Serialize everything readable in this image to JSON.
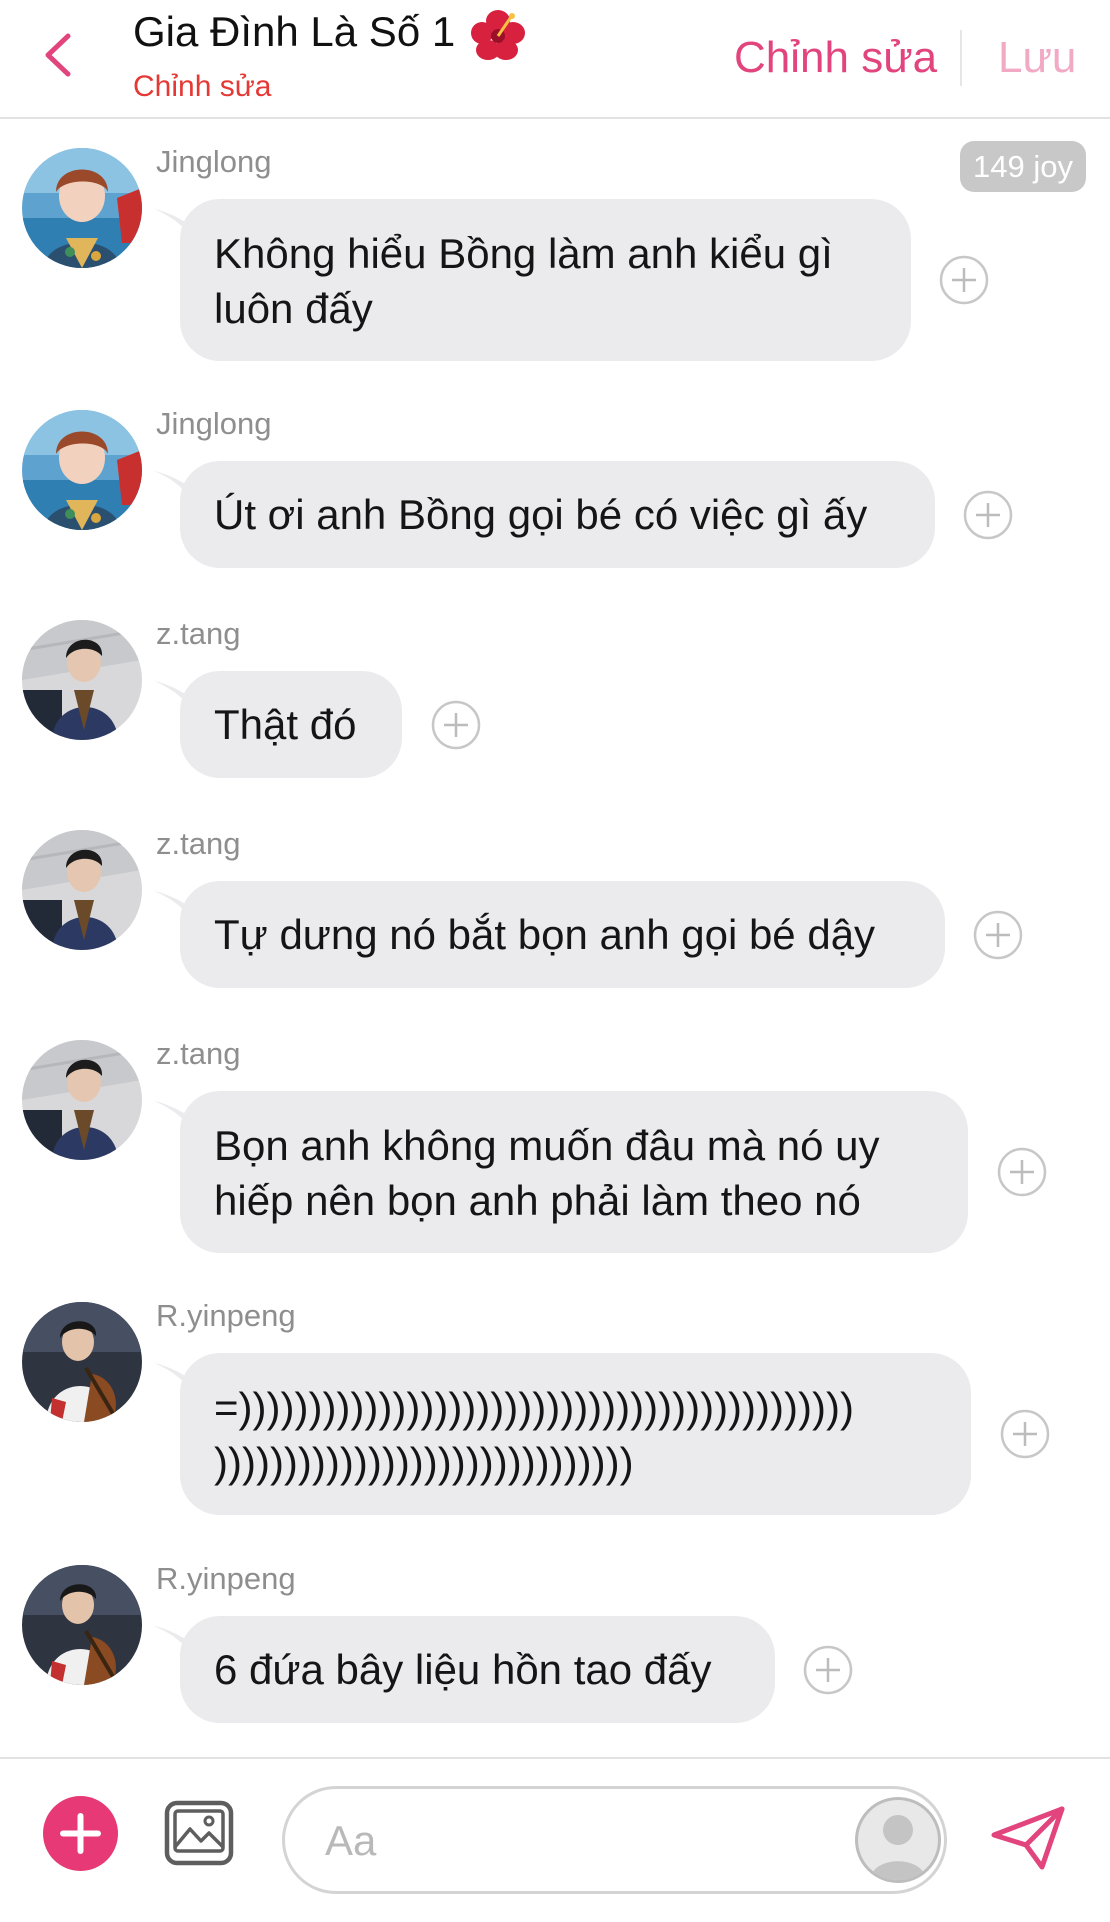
{
  "header": {
    "title": "Gia Đình Là Số 1",
    "subtitle": "Chỉnh sửa",
    "edit_label": "Chỉnh sửa",
    "save_label": "Lưu",
    "title_icon": "hibiscus-emoji",
    "back_icon": "chevron-left-icon"
  },
  "joy_badge": "149 joy",
  "messages": [
    {
      "user": "Jinglong",
      "lines": "Không hiểu Bồng làm anh kiểu gì\nluôn đấy",
      "avatar": "jinglong"
    },
    {
      "user": "Jinglong",
      "lines": "Út ơi anh Bồng gọi bé có việc gì ấy",
      "avatar": "jinglong"
    },
    {
      "user": "z.tang",
      "lines": "Thật đó",
      "avatar": "ztang"
    },
    {
      "user": "z.tang",
      "lines": "Tự dưng nó bắt bọn anh gọi bé dậy",
      "avatar": "ztang"
    },
    {
      "user": "z.tang",
      "lines": "Bọn anh không muốn đâu mà nó uy\nhiếp nên bọn anh phải làm theo nó",
      "avatar": "ztang"
    },
    {
      "user": "R.yinpeng",
      "lines": "=))))))))))))))))))))))))))))))))))))))))))))\n))))))))))))))))))))))))))))))",
      "avatar": "ryinpeng"
    },
    {
      "user": "R.yinpeng",
      "lines": "6 đứa bây liệu hồn tao đấy",
      "avatar": "ryinpeng"
    }
  ],
  "composer": {
    "placeholder": "Aa",
    "add_icon": "plus-icon",
    "image_icon": "image-icon",
    "send_icon": "send-icon"
  },
  "colors": {
    "accent": "#e2457e",
    "subtitle": "#e53935",
    "bubble": "#ebebee",
    "save_disabled": "#f2a9c4"
  }
}
